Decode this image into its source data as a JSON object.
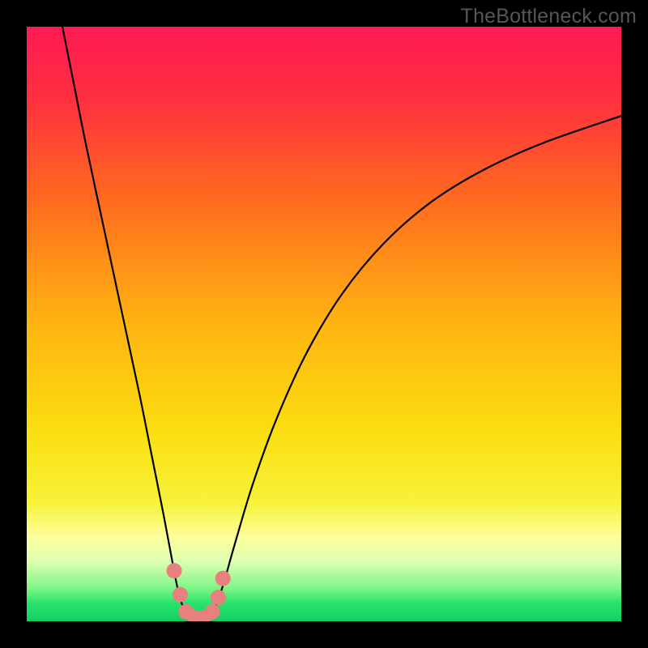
{
  "watermark": "TheBottleneck.com",
  "chart_data": {
    "type": "line",
    "title": "",
    "xlabel": "",
    "ylabel": "",
    "xlim": [
      0,
      100
    ],
    "ylim": [
      0,
      100
    ],
    "background": {
      "type": "vertical-gradient",
      "stops": [
        {
          "offset": 0.0,
          "color": "#ff1a54"
        },
        {
          "offset": 0.12,
          "color": "#ff2f3f"
        },
        {
          "offset": 0.3,
          "color": "#ff6e1e"
        },
        {
          "offset": 0.5,
          "color": "#ffb411"
        },
        {
          "offset": 0.68,
          "color": "#fade10"
        },
        {
          "offset": 0.8,
          "color": "#f7f23a"
        },
        {
          "offset": 0.86,
          "color": "#fdff9e"
        },
        {
          "offset": 0.9,
          "color": "#ddffb1"
        },
        {
          "offset": 0.945,
          "color": "#7df586"
        },
        {
          "offset": 0.97,
          "color": "#27e36a"
        },
        {
          "offset": 1.0,
          "color": "#13cf63"
        }
      ]
    },
    "series": [
      {
        "name": "bottleneck-curve",
        "color": "#000000",
        "points": [
          {
            "x": 6.0,
            "y": 100.0
          },
          {
            "x": 8.0,
            "y": 90.0
          },
          {
            "x": 10.0,
            "y": 80.0
          },
          {
            "x": 13.0,
            "y": 66.0
          },
          {
            "x": 16.0,
            "y": 52.0
          },
          {
            "x": 19.0,
            "y": 38.0
          },
          {
            "x": 21.0,
            "y": 28.0
          },
          {
            "x": 23.0,
            "y": 18.0
          },
          {
            "x": 24.5,
            "y": 10.0
          },
          {
            "x": 25.5,
            "y": 5.0
          },
          {
            "x": 26.5,
            "y": 2.0
          },
          {
            "x": 28.0,
            "y": 0.5
          },
          {
            "x": 30.0,
            "y": 0.5
          },
          {
            "x": 31.5,
            "y": 2.0
          },
          {
            "x": 33.0,
            "y": 6.0
          },
          {
            "x": 35.0,
            "y": 13.0
          },
          {
            "x": 38.0,
            "y": 23.0
          },
          {
            "x": 42.0,
            "y": 34.0
          },
          {
            "x": 47.0,
            "y": 45.0
          },
          {
            "x": 53.0,
            "y": 55.0
          },
          {
            "x": 60.0,
            "y": 63.5
          },
          {
            "x": 68.0,
            "y": 70.5
          },
          {
            "x": 77.0,
            "y": 76.0
          },
          {
            "x": 87.0,
            "y": 80.5
          },
          {
            "x": 100.0,
            "y": 85.0
          }
        ]
      }
    ],
    "markers": [
      {
        "name": "marker",
        "color": "#e98080",
        "x": 24.8,
        "y": 8.5
      },
      {
        "name": "marker",
        "color": "#e98080",
        "x": 25.8,
        "y": 4.5
      },
      {
        "name": "marker",
        "color": "#e98080",
        "x": 26.8,
        "y": 1.6
      },
      {
        "name": "marker",
        "color": "#e98080",
        "x": 28.2,
        "y": 0.6
      },
      {
        "name": "marker",
        "color": "#e98080",
        "x": 29.8,
        "y": 0.6
      },
      {
        "name": "marker",
        "color": "#e98080",
        "x": 31.2,
        "y": 1.6
      },
      {
        "name": "marker",
        "color": "#e98080",
        "x": 32.2,
        "y": 4.0
      },
      {
        "name": "marker",
        "color": "#e98080",
        "x": 33.0,
        "y": 7.2
      }
    ]
  }
}
